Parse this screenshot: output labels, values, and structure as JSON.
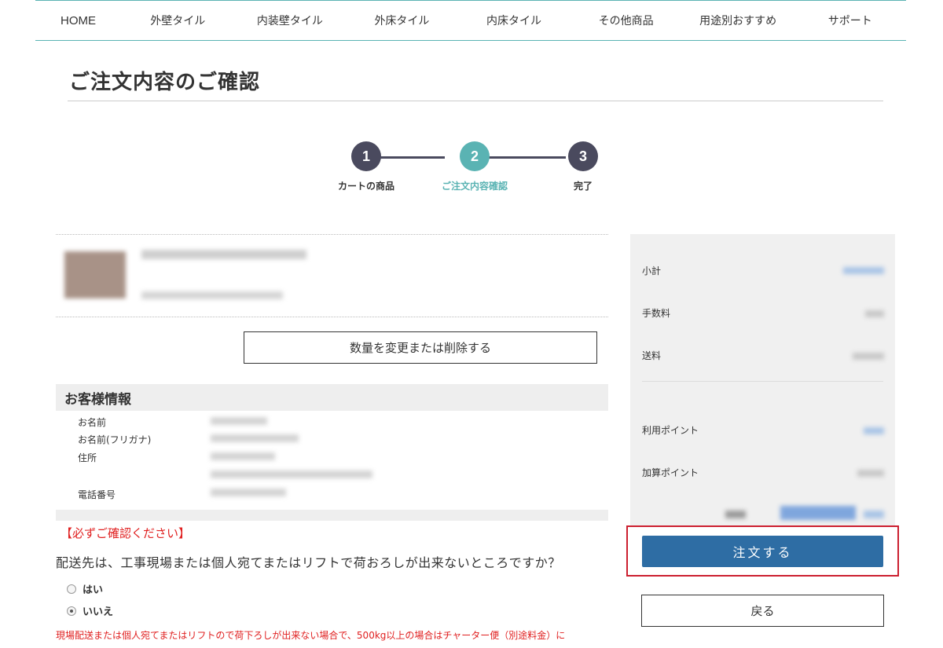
{
  "nav": {
    "items": [
      "HOME",
      "外壁タイル",
      "内装壁タイル",
      "外床タイル",
      "内床タイル",
      "その他商品",
      "用途別おすすめ",
      "サポート"
    ]
  },
  "page": {
    "title": "ご注文内容のご確認"
  },
  "steps": [
    {
      "number": "1",
      "label": "カートの商品",
      "state": "done"
    },
    {
      "number": "2",
      "label": "ご注文内容確認",
      "state": "active"
    },
    {
      "number": "3",
      "label": "完了",
      "state": "pending"
    }
  ],
  "cart": {
    "change_button": "数量を変更または削除する"
  },
  "customer": {
    "heading": "お客様情報",
    "labels": {
      "name": "お名前",
      "kana": "お名前(フリガナ)",
      "address": "住所",
      "phone": "電話番号"
    }
  },
  "notice": {
    "title": "【必ずご確認ください】",
    "question": "配送先は、工事現場または個人宛てまたはリフトで荷おろしが出来ないところですか？",
    "options": [
      {
        "label": "はい",
        "checked": false
      },
      {
        "label": "いいえ",
        "checked": true
      }
    ],
    "footnote": "現場配送または個人宛てまたはリフトので荷下ろしが出来ない場合で、500kg以上の場合はチャーター便（別途料金）に"
  },
  "summary": {
    "subtotal_label": "小計",
    "fee_label": "手数料",
    "shipping_label": "送料",
    "use_points_label": "利用ポイント",
    "add_points_label": "加算ポイント",
    "order_button": "注文する",
    "back_button": "戻る"
  },
  "colors": {
    "accent": "#5ab3b3",
    "step_dark": "#4a4a5e",
    "order_button": "#2e6da4",
    "notice_red": "#e02020",
    "highlight_frame": "#cc1f2f"
  }
}
